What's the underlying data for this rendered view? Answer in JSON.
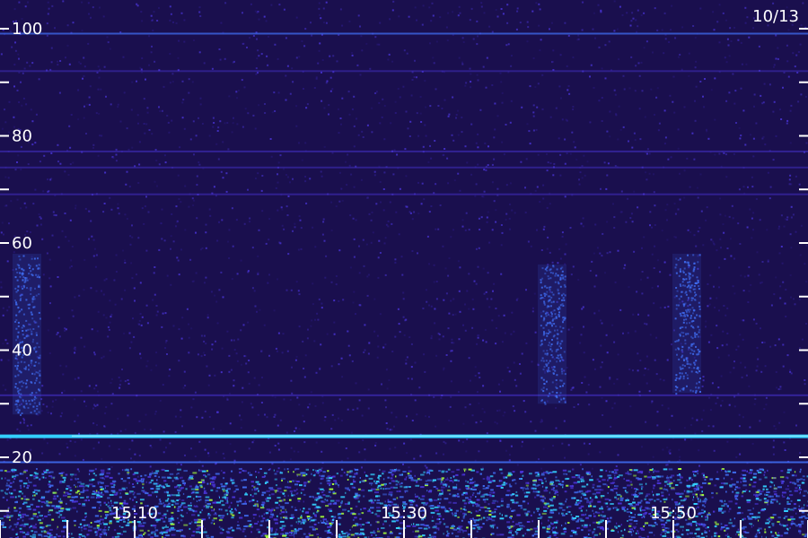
{
  "chart_data": {
    "type": "heatmap",
    "title": "",
    "date_label": "10/13",
    "xlabel": "",
    "ylabel": "",
    "x_range": [
      "15:00",
      "15:60"
    ],
    "x_ticks": [
      {
        "value": "15:10",
        "label": "15:10"
      },
      {
        "value": "15:30",
        "label": "15:30"
      },
      {
        "value": "15:50",
        "label": "15:50"
      }
    ],
    "x_minor_tick_interval_min": 5,
    "ylim": [
      10,
      105
    ],
    "y_ticks": [
      {
        "value": 100,
        "label": "100"
      },
      {
        "value": 80,
        "label": "80"
      },
      {
        "value": 60,
        "label": "60"
      },
      {
        "value": 40,
        "label": "40"
      },
      {
        "value": 20,
        "label": "20"
      }
    ],
    "y_minor_ticks": [
      90,
      70,
      50,
      30,
      10
    ],
    "colors": {
      "background": "#1a0f4e",
      "noise_low": "#2a1a80",
      "noise_high": "#4a35d8",
      "line_mid": "#3f6cf0",
      "line_strong": "#33d0ff",
      "hot": "#a6ff3a",
      "axis": "#ffffff"
    },
    "horizontal_bands": [
      {
        "frequency": 99,
        "strength": 0.45
      },
      {
        "frequency": 92,
        "strength": 0.15
      },
      {
        "frequency": 77,
        "strength": 0.2
      },
      {
        "frequency": 74,
        "strength": 0.15
      },
      {
        "frequency": 69,
        "strength": 0.18
      },
      {
        "frequency": 31.5,
        "strength": 0.25
      },
      {
        "frequency": 24,
        "strength": 1.0
      },
      {
        "frequency": 19,
        "strength": 0.6
      }
    ],
    "vertical_bursts": [
      {
        "time": "15:02",
        "f_low": 28,
        "f_high": 58,
        "strength": 0.35
      },
      {
        "time": "15:41",
        "f_low": 30,
        "f_high": 56,
        "strength": 0.3
      },
      {
        "time": "15:51",
        "f_low": 32,
        "f_high": 58,
        "strength": 0.3
      }
    ],
    "low_frequency_noise": {
      "f_low": 10,
      "f_high": 18,
      "strength": 0.8
    }
  }
}
